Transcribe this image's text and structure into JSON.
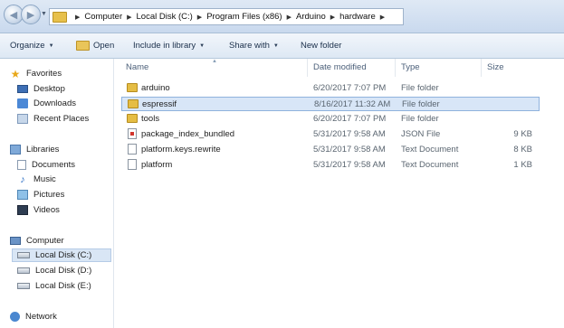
{
  "breadcrumb": {
    "items": [
      "Computer",
      "Local Disk (C:)",
      "Program Files (x86)",
      "Arduino",
      "hardware"
    ]
  },
  "toolbar": {
    "organize": "Organize",
    "open": "Open",
    "include_in_library": "Include in library",
    "share_with": "Share with",
    "new_folder": "New folder"
  },
  "nav": {
    "favorites": "Favorites",
    "desktop": "Desktop",
    "downloads": "Downloads",
    "recent_places": "Recent Places",
    "libraries": "Libraries",
    "documents": "Documents",
    "music": "Music",
    "pictures": "Pictures",
    "videos": "Videos",
    "computer": "Computer",
    "disk_c": "Local Disk (C:)",
    "disk_d": "Local Disk (D:)",
    "disk_e": "Local Disk (E:)",
    "network": "Network"
  },
  "columns": {
    "name": "Name",
    "date_modified": "Date modified",
    "type": "Type",
    "size": "Size"
  },
  "files": [
    {
      "name": "arduino",
      "date": "6/20/2017 7:07 PM",
      "type": "File folder",
      "size": "",
      "icon": "folder"
    },
    {
      "name": "espressif",
      "date": "8/16/2017 11:32 AM",
      "type": "File folder",
      "size": "",
      "icon": "folder"
    },
    {
      "name": "tools",
      "date": "6/20/2017 7:07 PM",
      "type": "File folder",
      "size": "",
      "icon": "folder"
    },
    {
      "name": "package_index_bundled",
      "date": "5/31/2017 9:58 AM",
      "type": "JSON File",
      "size": "9 KB",
      "icon": "json-file"
    },
    {
      "name": "platform.keys.rewrite",
      "date": "5/31/2017 9:58 AM",
      "type": "Text Document",
      "size": "8 KB",
      "icon": "text-file"
    },
    {
      "name": "platform",
      "date": "5/31/2017 9:58 AM",
      "type": "Text Document",
      "size": "1 KB",
      "icon": "text-file"
    }
  ],
  "colors": {
    "selection": "#d8e6f7",
    "folder": "#e5bd44",
    "toolbar_text": "#1a2f4a"
  }
}
